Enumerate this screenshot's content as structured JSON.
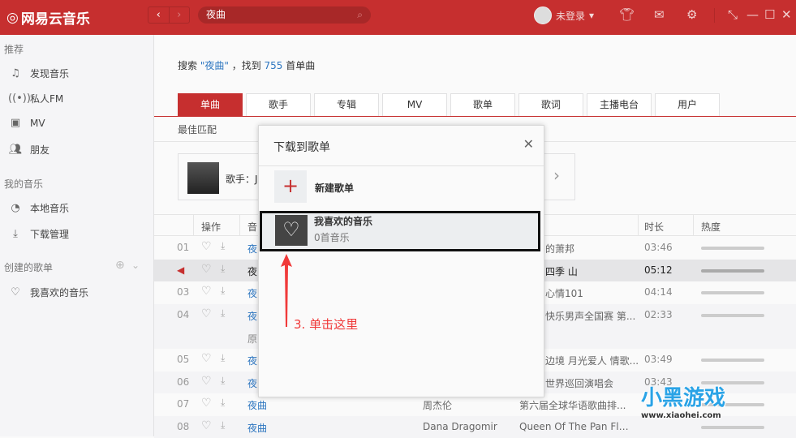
{
  "app": {
    "title": "网易云音乐",
    "search_value": "夜曲",
    "user": "未登录"
  },
  "sidebar": {
    "recommend": "推荐",
    "items": [
      {
        "label": "发现音乐"
      },
      {
        "label": "私人FM"
      },
      {
        "label": "MV"
      },
      {
        "label": "朋友"
      }
    ],
    "my_music": "我的音乐",
    "my_items": [
      {
        "label": "本地音乐"
      },
      {
        "label": "下载管理"
      }
    ],
    "created": "创建的歌单",
    "playlists": [
      {
        "label": "我喜欢的音乐"
      }
    ]
  },
  "summary": {
    "prefix": "搜索 ",
    "keyword": "\"夜曲\"",
    "mid": " ，找到 ",
    "count": "755",
    "suffix": " 首单曲"
  },
  "tabs": [
    "单曲",
    "歌手",
    "专辑",
    "MV",
    "歌单",
    "歌词",
    "主播电台",
    "用户"
  ],
  "best_match": "最佳匹配",
  "card": {
    "artist_label": "歌手：J"
  },
  "table": {
    "headers": {
      "ops": "操作",
      "title": "音",
      "duration": "时长",
      "hot": "热度"
    },
    "rows": [
      {
        "num": "01",
        "title": "夜",
        "frag": "的萧邦",
        "dur": "03:46"
      },
      {
        "num": "",
        "title": "夜",
        "frag": "四季 山",
        "dur": "05:12",
        "playing": true
      },
      {
        "num": "03",
        "title": "夜",
        "frag": "心情101",
        "dur": "04:14"
      },
      {
        "num": "04",
        "title": "夜",
        "frag": "快乐男声全国赛 第...",
        "dur": "02:33",
        "sub": "原"
      },
      {
        "num": "05",
        "title": "夜",
        "frag": "边境 月光爱人 情歌...",
        "dur": "03:49"
      },
      {
        "num": "06",
        "title": "夜",
        "frag": "世界巡回演唱会",
        "dur": "03:43"
      },
      {
        "num": "07",
        "title": "夜曲",
        "singer": "周杰伦",
        "album": "第六届全球华语歌曲排...",
        "dur": ""
      },
      {
        "num": "08",
        "title": "夜曲",
        "singer": "Dana Dragomir",
        "album": "Queen Of The Pan Flute",
        "dur": ""
      }
    ]
  },
  "dialog": {
    "title": "下载到歌单",
    "new_playlist": "新建歌单",
    "fav_name": "我喜欢的音乐",
    "fav_count": "0首音乐"
  },
  "annotation": "3. 单击这里",
  "watermark": {
    "text": "小黑游戏",
    "url": "www.xiaohei.com"
  },
  "colors": {
    "brand": "#c62f2f",
    "link": "#2d76c0",
    "annotation": "#f03a3a"
  }
}
